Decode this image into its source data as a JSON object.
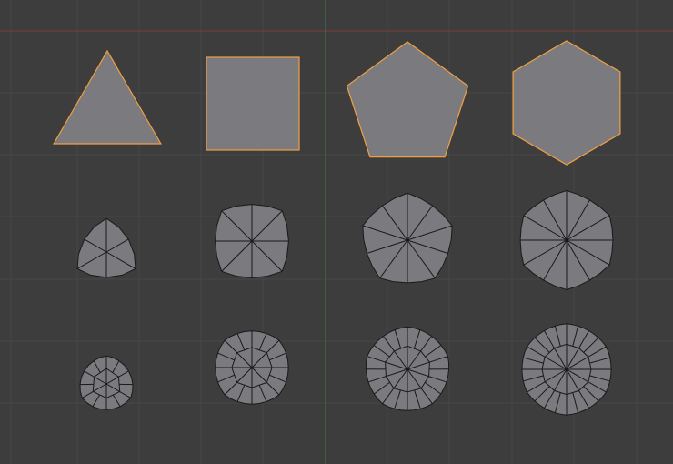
{
  "viewport": {
    "background": "#3d3d3d",
    "grid_color": "#474747",
    "x_axis_color": "#7a3b3b",
    "y_axis_color": "#3f7a3f",
    "face_color": "#7b7b7f",
    "edge_color": "#1a1a1a",
    "selected_edge_color": "#f0a040"
  },
  "rows": [
    {
      "name": "base-polygons",
      "subdivision_levels": 0,
      "selected": true,
      "shapes": [
        {
          "name": "triangle",
          "sides": 3
        },
        {
          "name": "square",
          "sides": 4
        },
        {
          "name": "pentagon",
          "sides": 5
        },
        {
          "name": "hexagon",
          "sides": 6
        }
      ]
    },
    {
      "name": "subdivided-level-1",
      "subdivision_levels": 1,
      "selected": false,
      "shapes": [
        {
          "name": "triangle",
          "sides": 3
        },
        {
          "name": "square",
          "sides": 4
        },
        {
          "name": "pentagon",
          "sides": 5
        },
        {
          "name": "hexagon",
          "sides": 6
        }
      ]
    },
    {
      "name": "subdivided-level-2",
      "subdivision_levels": 2,
      "selected": false,
      "shapes": [
        {
          "name": "triangle",
          "sides": 3
        },
        {
          "name": "square",
          "sides": 4
        },
        {
          "name": "pentagon",
          "sides": 5
        },
        {
          "name": "hexagon",
          "sides": 6
        }
      ]
    }
  ]
}
